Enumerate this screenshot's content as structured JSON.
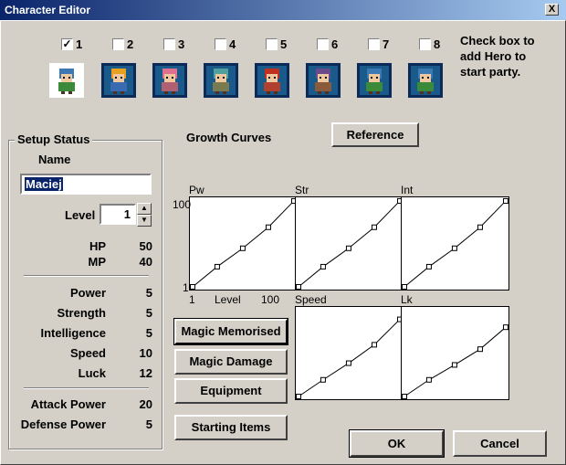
{
  "window": {
    "title": "Character Editor",
    "close_glyph": "X"
  },
  "party": {
    "slots": [
      {
        "label": "1",
        "checked": true
      },
      {
        "label": "2",
        "checked": false
      },
      {
        "label": "3",
        "checked": false
      },
      {
        "label": "4",
        "checked": false
      },
      {
        "label": "5",
        "checked": false
      },
      {
        "label": "6",
        "checked": false
      },
      {
        "label": "7",
        "checked": false
      },
      {
        "label": "8",
        "checked": false
      }
    ],
    "check_glyph": "✓",
    "hint_line1": "Check box to",
    "hint_line2": "add Hero to",
    "hint_line3": "start party."
  },
  "setup": {
    "title": "Setup Status",
    "name_label": "Name",
    "name_value": "Maciej",
    "level_label": "Level",
    "level_value": "1",
    "hp_label": "HP",
    "hp_value": "50",
    "mp_label": "MP",
    "mp_value": "40",
    "power_label": "Power",
    "power_value": "5",
    "strength_label": "Strength",
    "strength_value": "5",
    "intelligence_label": "Intelligence",
    "intelligence_value": "5",
    "speed_label": "Speed",
    "speed_value": "10",
    "luck_label": "Luck",
    "luck_value": "12",
    "attack_label": "Attack Power",
    "attack_value": "20",
    "defense_label": "Defense Power",
    "defense_value": "5"
  },
  "growth": {
    "title": "Growth Curves",
    "reference_button": "Reference",
    "axis": {
      "ymax": "100",
      "ymin": "1",
      "xmin": "1",
      "xmax": "100",
      "xlabel": "Level"
    },
    "curves": [
      {
        "name": "Pw",
        "points": [
          [
            1,
            1
          ],
          [
            25,
            24
          ],
          [
            50,
            45
          ],
          [
            75,
            69
          ],
          [
            100,
            99
          ]
        ]
      },
      {
        "name": "Str",
        "points": [
          [
            1,
            1
          ],
          [
            25,
            24
          ],
          [
            50,
            45
          ],
          [
            75,
            69
          ],
          [
            100,
            99
          ]
        ]
      },
      {
        "name": "Int",
        "points": [
          [
            1,
            1
          ],
          [
            25,
            24
          ],
          [
            50,
            45
          ],
          [
            75,
            69
          ],
          [
            100,
            99
          ]
        ]
      },
      {
        "name": "Speed",
        "points": [
          [
            1,
            1
          ],
          [
            25,
            20
          ],
          [
            50,
            39
          ],
          [
            75,
            60
          ],
          [
            100,
            89
          ]
        ]
      },
      {
        "name": "Lk",
        "points": [
          [
            1,
            1
          ],
          [
            25,
            20
          ],
          [
            50,
            37
          ],
          [
            75,
            55
          ],
          [
            100,
            80
          ]
        ]
      }
    ]
  },
  "buttons": {
    "magic_memorised": "Magic Memorised",
    "magic_damage": "Magic Damage",
    "equipment": "Equipment",
    "starting_items": "Starting Items",
    "ok": "OK",
    "cancel": "Cancel"
  }
}
